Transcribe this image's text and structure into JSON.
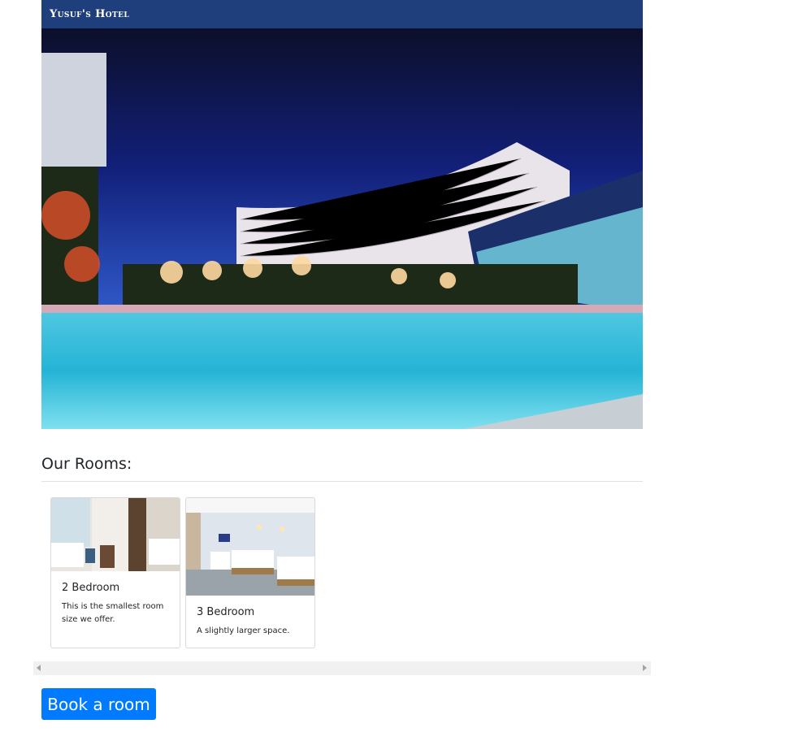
{
  "header": {
    "brand": "Yusuf's Hotel"
  },
  "hero": {
    "image": "hotel-pool-night-photo"
  },
  "rooms": {
    "title": "Our Rooms:",
    "cards": [
      {
        "title": "2 Bedroom",
        "text": "This is the smallest room size we offer.",
        "image": "two-bedroom-photo"
      },
      {
        "title": "3 Bedroom",
        "text": "A slightly larger space.",
        "image": "three-bedroom-photo"
      }
    ]
  },
  "scrollbar": {
    "left_icon": "scroll-left-arrow-icon",
    "right_icon": "scroll-right-arrow-icon"
  },
  "actions": {
    "book_label": "Book a room"
  },
  "colors": {
    "header_bg": "#1f3e7c",
    "button_bg": "#007bff"
  }
}
